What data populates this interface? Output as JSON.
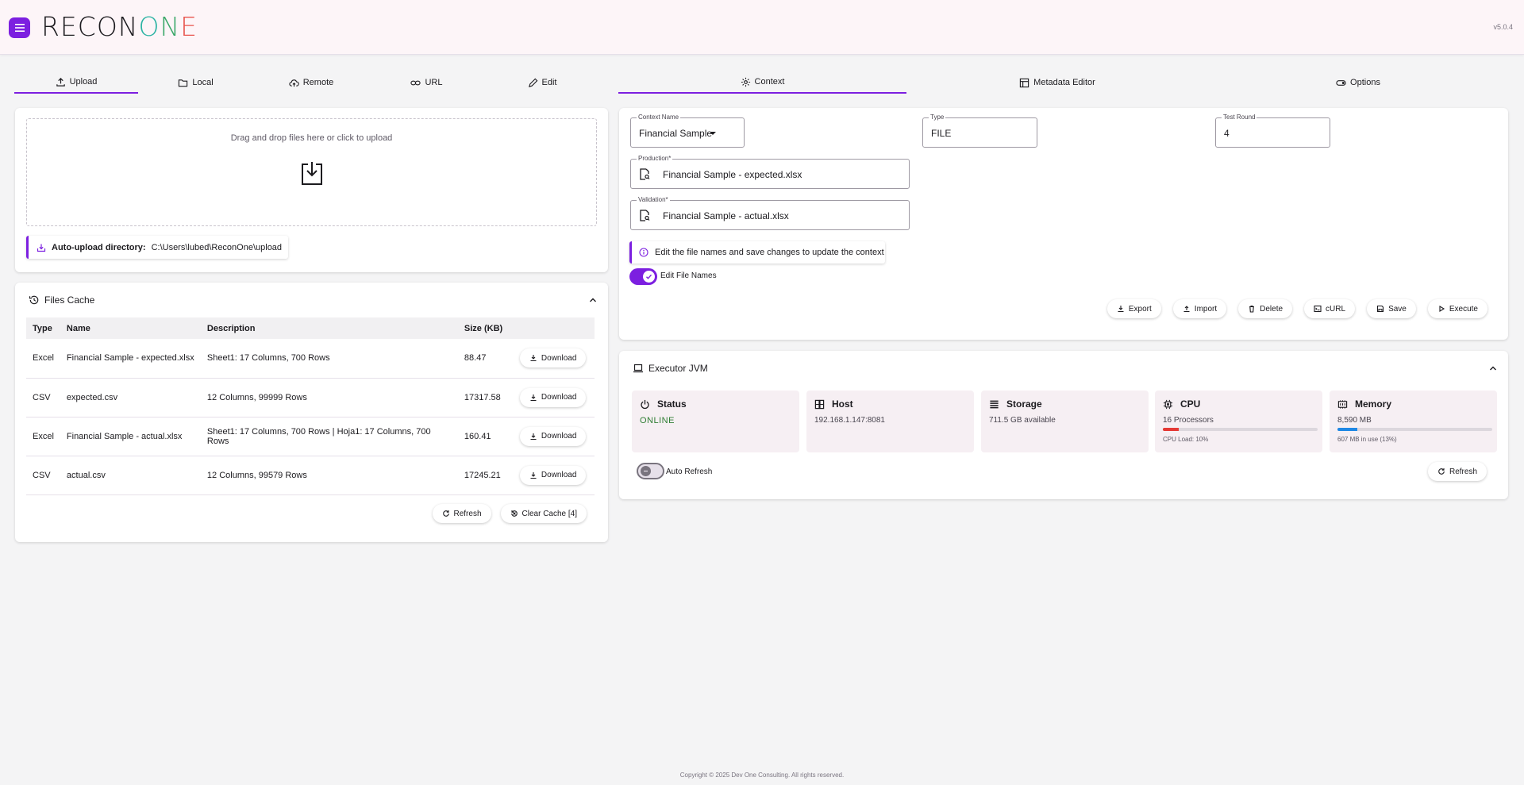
{
  "app": {
    "logo": "RECONONE",
    "version": "v5.0.4"
  },
  "left_tabs": [
    {
      "label": "Upload",
      "icon": "upload-icon",
      "active": true
    },
    {
      "label": "Local",
      "icon": "folder-icon"
    },
    {
      "label": "Remote",
      "icon": "cloud-upload-icon"
    },
    {
      "label": "URL",
      "icon": "link-icon"
    },
    {
      "label": "Edit",
      "icon": "pencil-icon"
    }
  ],
  "right_tabs": [
    {
      "label": "Context",
      "icon": "gear-icon",
      "active": true
    },
    {
      "label": "Metadata Editor",
      "icon": "table-edit-icon"
    },
    {
      "label": "Options",
      "icon": "toggle-icon"
    }
  ],
  "upload": {
    "dropzone_text": "Drag and drop files here or click to upload",
    "auto_label": "Auto-upload directory:",
    "auto_path": "C:\\Users\\lubed\\ReconOne\\upload"
  },
  "files_cache": {
    "title": "Files Cache",
    "headers": [
      "Type",
      "Name",
      "Description",
      "Size (KB)"
    ],
    "rows": [
      {
        "type": "Excel",
        "name": "Financial Sample - expected.xlsx",
        "description": "Sheet1: 17 Columns, 700 Rows",
        "size": "88.47",
        "action": "Download"
      },
      {
        "type": "CSV",
        "name": "expected.csv",
        "description": "12 Columns, 99999 Rows",
        "size": "17317.58",
        "action": "Download"
      },
      {
        "type": "Excel",
        "name": "Financial Sample - actual.xlsx",
        "description": "Sheet1: 17 Columns, 700 Rows | Hoja1: 17 Columns, 700 Rows",
        "size": "160.41",
        "action": "Download"
      },
      {
        "type": "CSV",
        "name": "actual.csv",
        "description": "12 Columns, 99579 Rows",
        "size": "17245.21",
        "action": "Download"
      }
    ],
    "refresh_label": "Refresh",
    "clear_label": "Clear Cache [4]"
  },
  "context": {
    "name_label": "Context Name",
    "name_value": "Financial Sample",
    "type_label": "Type",
    "type_value": "FILE",
    "round_label": "Test Round",
    "round_value": "4",
    "production_label": "Production*",
    "production_value": "Financial Sample - expected.xlsx",
    "validation_label": "Validation*",
    "validation_value": "Financial Sample - actual.xlsx",
    "info_text": "Edit the file names and save changes to update the context",
    "edit_toggle_label": "Edit File Names",
    "edit_toggle_on": true,
    "actions": [
      "Export",
      "Import",
      "Delete",
      "cURL",
      "Save",
      "Execute"
    ]
  },
  "executor": {
    "title": "Executor JVM",
    "status": {
      "title": "Status",
      "value": "ONLINE",
      "color": "#2e7d32"
    },
    "host": {
      "title": "Host",
      "value": "192.168.1.147:8081"
    },
    "storage": {
      "title": "Storage",
      "value": "711.5 GB available"
    },
    "cpu": {
      "title": "CPU",
      "value": "16 Processors",
      "load": 0.1,
      "sub": "CPU Load: 10%",
      "bar_color": "#e53935"
    },
    "memory": {
      "title": "Memory",
      "value": "8,590 MB",
      "usage": 0.13,
      "sub": "607 MB in use (13%)",
      "bar_color": "#1e88e5"
    },
    "auto_refresh_label": "Auto Refresh",
    "auto_refresh_on": false,
    "refresh_label": "Refresh"
  },
  "footer": "Copyright © 2025 Dev One Consulting. All rights reserved.",
  "colors": {
    "accent": "#7c1fe0",
    "header_bg": "#fdf5f8",
    "page_bg": "#f4f4f5"
  }
}
